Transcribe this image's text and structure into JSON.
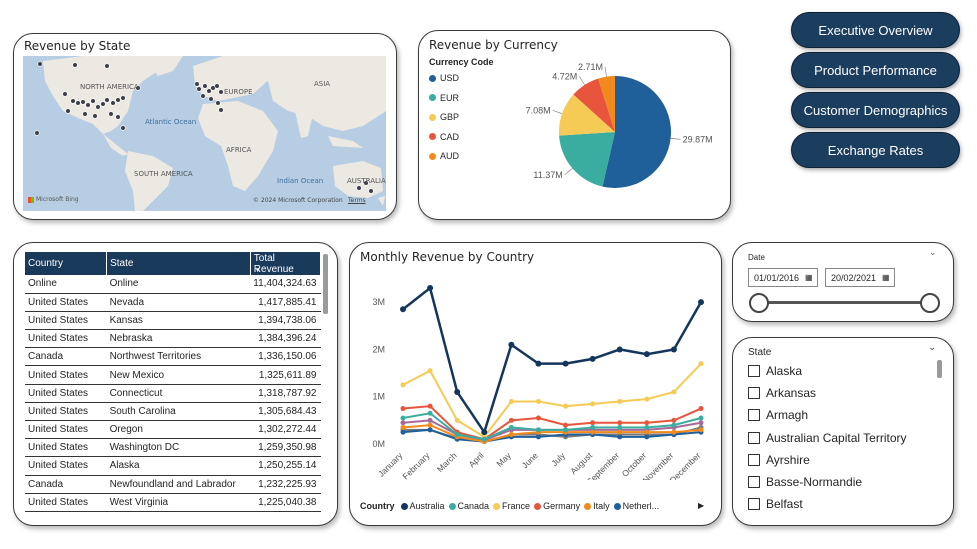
{
  "nav": {
    "buttons": [
      "Executive Overview",
      "Product Performance",
      "Customer Demographics",
      "Exchange Rates"
    ]
  },
  "map_card": {
    "title": "Revenue by State",
    "labels": {
      "north_america": "NORTH AMERICA",
      "europe": "EUROPE",
      "asia": "ASIA",
      "atlantic": "Atlantic Ocean",
      "africa": "AFRICA",
      "south_america": "SOUTH AMERICA",
      "indian": "Indian Ocean",
      "australia": "AUSTRALIA"
    },
    "bing": "Microsoft Bing",
    "copyright": "© 2024 Microsoft Corporation",
    "terms": "Terms"
  },
  "currency_card": {
    "title": "Revenue by Currency",
    "legend_title": "Currency Code"
  },
  "table": {
    "headers": [
      "Country",
      "State",
      "Total Revenue"
    ],
    "rows": [
      [
        "Online",
        "Online",
        "11,404,324.63"
      ],
      [
        "United States",
        "Nevada",
        "1,417,885.41"
      ],
      [
        "United States",
        "Kansas",
        "1,394,738.06"
      ],
      [
        "United States",
        "Nebraska",
        "1,384,396.24"
      ],
      [
        "Canada",
        "Northwest Territories",
        "1,336,150.06"
      ],
      [
        "United States",
        "New Mexico",
        "1,325,611.89"
      ],
      [
        "United States",
        "Connecticut",
        "1,318,787.92"
      ],
      [
        "United States",
        "South Carolina",
        "1,305,684.43"
      ],
      [
        "United States",
        "Oregon",
        "1,302,272.44"
      ],
      [
        "United States",
        "Washington DC",
        "1,259,350.98"
      ],
      [
        "United States",
        "Alaska",
        "1,250,255.14"
      ],
      [
        "Canada",
        "Newfoundland and Labrador",
        "1,232,225.93"
      ],
      [
        "United States",
        "West Virginia",
        "1,225,040.38"
      ]
    ]
  },
  "date_slicer": {
    "label": "Date",
    "start": "01/01/2016",
    "end": "20/02/2021"
  },
  "state_slicer": {
    "label": "State",
    "items": [
      "Alaska",
      "Arkansas",
      "Armagh",
      "Australian Capital Territory",
      "Ayrshire",
      "Basse-Normandie",
      "Belfast"
    ]
  },
  "chart_data": [
    {
      "type": "pie",
      "title": "Revenue by Currency",
      "legend_title": "Currency Code",
      "categories": [
        "USD",
        "EUR",
        "GBP",
        "CAD",
        "AUD"
      ],
      "values": [
        29.87,
        11.37,
        7.08,
        4.72,
        2.71
      ],
      "value_labels": [
        "29.87M",
        "11.37M",
        "7.08M",
        "4.72M",
        "2.71M"
      ],
      "colors": [
        "#1f5f9a",
        "#3aada0",
        "#f5cb55",
        "#e8553d",
        "#f18a1c"
      ],
      "legend_position": "left"
    },
    {
      "type": "line",
      "title": "Monthly Revenue by Country",
      "categories": [
        "January",
        "February",
        "March",
        "April",
        "May",
        "June",
        "July",
        "August",
        "September",
        "October",
        "November",
        "December"
      ],
      "ylim": [
        0,
        3.3
      ],
      "yticks": [
        "0M",
        "1M",
        "2M",
        "3M"
      ],
      "legend_title": "Country",
      "legend_position": "bottom",
      "series": [
        {
          "name": "Australia",
          "color": "#14365c",
          "values": [
            2.85,
            3.3,
            1.1,
            0.25,
            2.1,
            1.7,
            1.7,
            1.8,
            2.0,
            1.9,
            2.0,
            3.0
          ]
        },
        {
          "name": "Canada",
          "color": "#3aada0",
          "values": [
            0.55,
            0.65,
            0.2,
            0.1,
            0.35,
            0.3,
            0.3,
            0.35,
            0.35,
            0.35,
            0.4,
            0.55
          ]
        },
        {
          "name": "France",
          "color": "#f5cb55",
          "values": [
            1.25,
            1.55,
            0.5,
            0.15,
            0.9,
            0.9,
            0.8,
            0.85,
            0.9,
            0.95,
            1.1,
            1.7
          ]
        },
        {
          "name": "Germany",
          "color": "#e8553d",
          "values": [
            0.75,
            0.8,
            0.25,
            0.1,
            0.5,
            0.55,
            0.4,
            0.45,
            0.45,
            0.45,
            0.5,
            0.75
          ]
        },
        {
          "name": "Italy",
          "color": "#f18a1c",
          "values": [
            0.35,
            0.4,
            0.15,
            0.05,
            0.2,
            0.25,
            0.25,
            0.25,
            0.25,
            0.25,
            0.25,
            0.3
          ]
        },
        {
          "name": "Netherl...",
          "color": "#1f5f9a",
          "values": [
            0.25,
            0.3,
            0.1,
            0.05,
            0.15,
            0.15,
            0.2,
            0.2,
            0.15,
            0.15,
            0.2,
            0.25
          ]
        },
        {
          "name": "",
          "color": "#a66999",
          "values": [
            0.45,
            0.5,
            0.2,
            0.08,
            0.3,
            0.3,
            0.3,
            0.3,
            0.3,
            0.3,
            0.35,
            0.45
          ]
        },
        {
          "name": "",
          "color": "#7a7a7a",
          "values": [
            0.3,
            0.3,
            0.12,
            0.05,
            0.2,
            0.2,
            0.15,
            0.2,
            0.2,
            0.2,
            0.2,
            0.35
          ]
        }
      ]
    }
  ]
}
